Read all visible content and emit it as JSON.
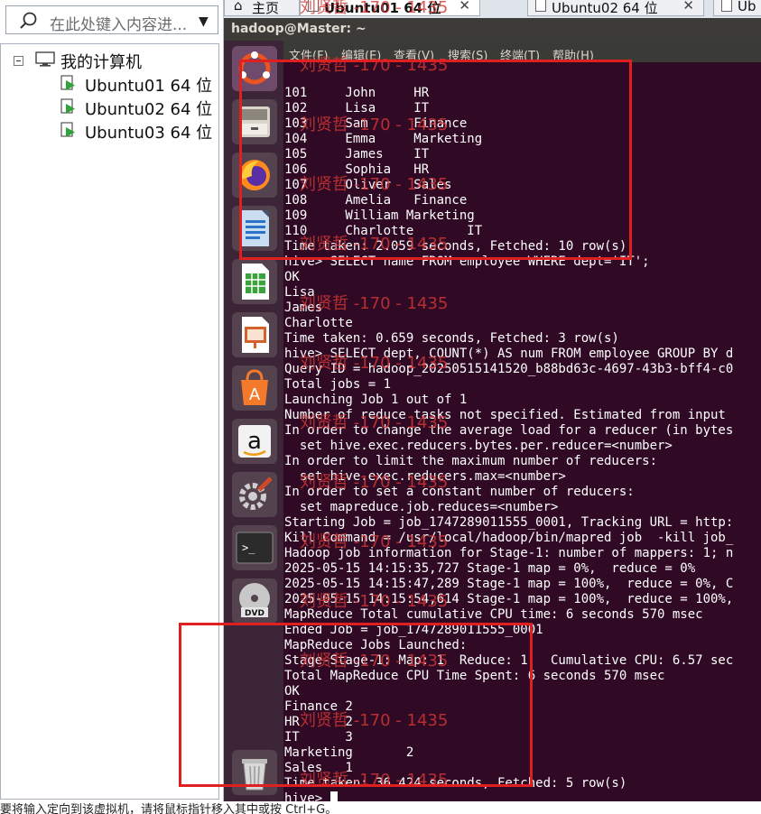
{
  "library": {
    "search_placeholder": "在此处键入内容进...",
    "root_label": "我的计算机",
    "vms": [
      "Ubuntu01 64 位",
      "Ubuntu02 64 位",
      "Ubuntu03 64 位"
    ]
  },
  "tabs": [
    {
      "label": "主页"
    },
    {
      "label": "Ubuntu01 64 位",
      "active": true
    },
    {
      "label": "Ubuntu02 64 位"
    },
    {
      "label": "Ub"
    }
  ],
  "terminal": {
    "title": "hadoop@Master: ~",
    "menu": [
      "文件(F)",
      "编辑(E)",
      "查看(V)",
      "搜索(S)",
      "终端(T)",
      "帮助(H)"
    ],
    "lines": [
      "101     John     HR",
      "102     Lisa     IT",
      "103     Sam      Finance",
      "104     Emma     Marketing",
      "105     James    IT",
      "106     Sophia   HR",
      "107     Oliver   Sales",
      "108     Amelia   Finance",
      "109     William Marketing",
      "110     Charlotte       IT",
      "Time taken: 2.059 seconds, Fetched: 10 row(s)",
      "hive> SELECT name FROM employee WHERE dept='IT';",
      "OK",
      "Lisa",
      "James",
      "Charlotte",
      "Time taken: 0.659 seconds, Fetched: 3 row(s)",
      "hive> SELECT dept, COUNT(*) AS num FROM employee GROUP BY d",
      "Query ID = hadoop_20250515141520_b88bd63c-4697-43b3-bff4-c0",
      "Total jobs = 1",
      "Launching Job 1 out of 1",
      "Number of reduce tasks not specified. Estimated from input",
      "In order to change the average load for a reducer (in bytes",
      "  set hive.exec.reducers.bytes.per.reducer=<number>",
      "In order to limit the maximum number of reducers:",
      "  set hive.exec.reducers.max=<number>",
      "In order to set a constant number of reducers:",
      "  set mapreduce.job.reduces=<number>",
      "Starting Job = job_1747289011555_0001, Tracking URL = http:",
      "Kill Command = /usr/local/hadoop/bin/mapred job  -kill job_",
      "Hadoop job information for Stage-1: number of mappers: 1; n",
      "2025-05-15 14:15:35,727 Stage-1 map = 0%,  reduce = 0%",
      "2025-05-15 14:15:47,289 Stage-1 map = 100%,  reduce = 0%, C",
      "2025-05-15 14:15:54,614 Stage-1 map = 100%,  reduce = 100%,",
      "MapReduce Total cumulative CPU time: 6 seconds 570 msec",
      "Ended Job = job_1747289011555_0001",
      "MapReduce Jobs Launched:",
      "Stage-Stage-1: Map: 1  Reduce: 1   Cumulative CPU: 6.57 sec",
      "Total MapReduce CPU Time Spent: 6 seconds 570 msec",
      "OK",
      "Finance 2",
      "HR      2",
      "IT      3",
      "Marketing       2",
      "Sales   1",
      "Time taken: 36.424 seconds, Fetched: 5 row(s)"
    ],
    "prompt": "hive> "
  },
  "launcher_icons": [
    "ubuntu-dash-icon",
    "files-icon",
    "firefox-icon",
    "writer-icon",
    "calc-icon",
    "impress-icon",
    "software-center-icon",
    "amazon-icon",
    "settings-icon",
    "terminal-icon",
    "dvd-icon",
    "trash-icon"
  ],
  "watermark": "刘贤哲 -170 - 1435",
  "status_text": "要将输入定向到该虚拟机，请将鼠标指针移入其中或按 Ctrl+G。",
  "colors": {
    "terminal_bg": "#300a24",
    "launcher_bg": "#3b2536",
    "highlight_box": "#e02020"
  }
}
